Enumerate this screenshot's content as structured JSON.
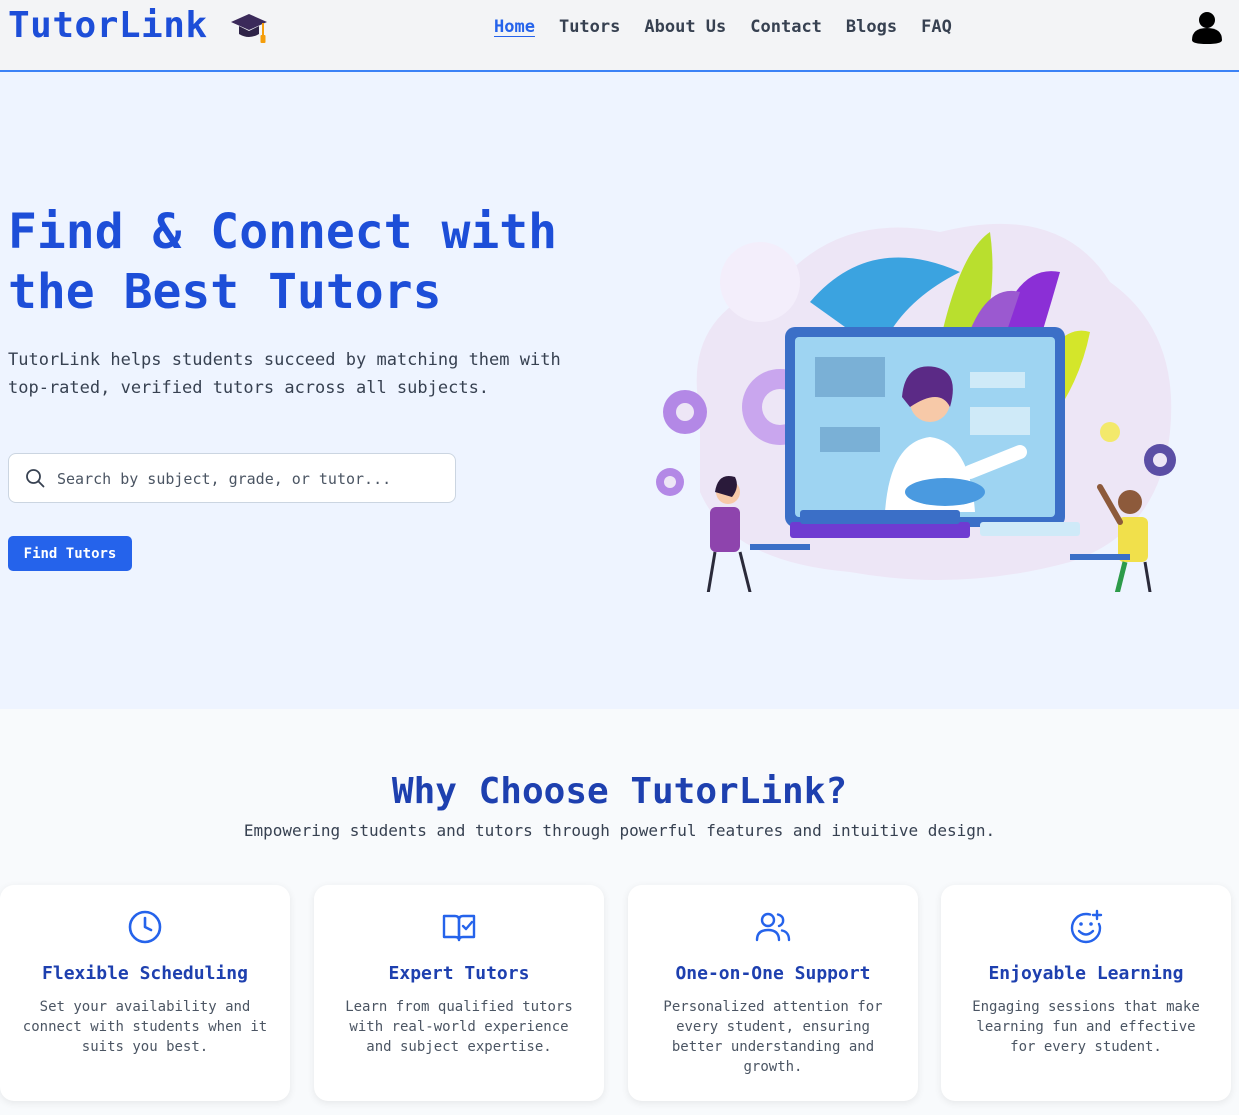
{
  "header": {
    "logo": "TutorLink",
    "nav": [
      {
        "label": "Home",
        "active": true
      },
      {
        "label": "Tutors",
        "active": false
      },
      {
        "label": "About Us",
        "active": false
      },
      {
        "label": "Contact",
        "active": false
      },
      {
        "label": "Blogs",
        "active": false
      },
      {
        "label": "FAQ",
        "active": false
      }
    ]
  },
  "hero": {
    "title": "Find & Connect with the Best Tutors",
    "subtitle": "TutorLink helps students succeed by matching them with top-rated, verified tutors across all subjects.",
    "search": {
      "placeholder": "Search by subject, grade, or tutor...",
      "value": ""
    },
    "cta_label": "Find Tutors"
  },
  "features": {
    "title": "Why Choose TutorLink?",
    "subtitle": "Empowering students and tutors through powerful features and intuitive design.",
    "cards": [
      {
        "icon": "clock-icon",
        "title": "Flexible Scheduling",
        "desc": "Set your availability and connect with students when it suits you best."
      },
      {
        "icon": "book-check-icon",
        "title": "Expert Tutors",
        "desc": "Learn from qualified tutors with real-world experience and subject expertise."
      },
      {
        "icon": "users-icon",
        "title": "One-on-One Support",
        "desc": "Personalized attention for every student, ensuring better understanding and growth."
      },
      {
        "icon": "smile-plus-icon",
        "title": "Enjoyable Learning",
        "desc": "Engaging sessions that make learning fun and effective for every student."
      }
    ]
  },
  "colors": {
    "brand": "#1d4ed8",
    "accent": "#2563eb",
    "hero_bg": "#eef4ff"
  }
}
